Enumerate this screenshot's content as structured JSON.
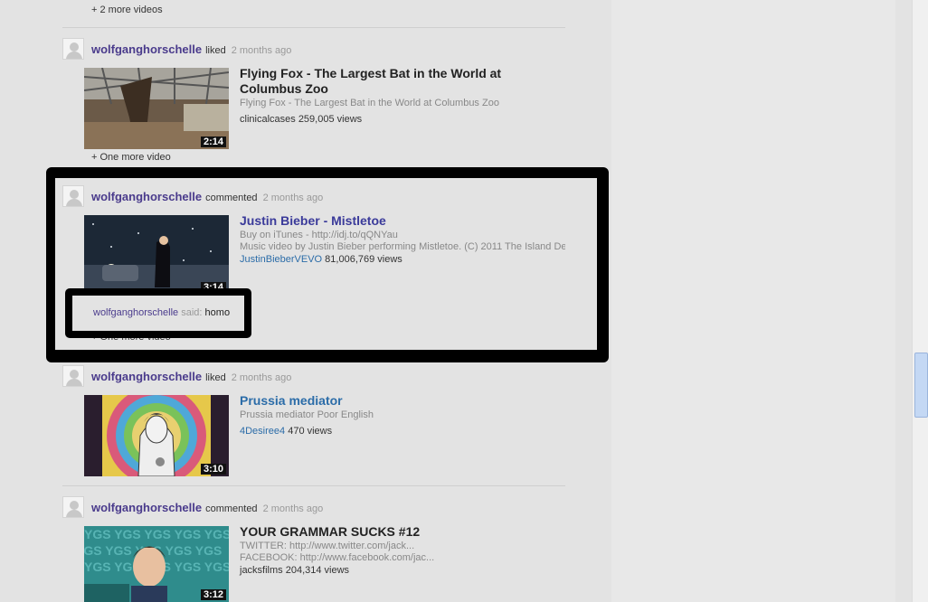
{
  "feed": {
    "top_more_link": "+ 2 more videos",
    "items": [
      {
        "user": "wolfganghorschelle",
        "action": "liked",
        "time": "2 months ago",
        "title": "Flying Fox - The Largest Bat in the World at Columbus Zoo",
        "description": [
          "Flying Fox - The Largest Bat in the World at Columbus Zoo"
        ],
        "channel": "clinicalcases",
        "views": "259,005 views",
        "duration": "2:14",
        "more_link": "+ One more video"
      },
      {
        "user": "wolfganghorschelle",
        "action": "commented",
        "time": "2 months ago",
        "title": "Justin Bieber - Mistletoe",
        "description": [
          "Buy on iTunes - http://idj.to/qQNYau",
          "Music video by Justin Bieber performing Mistletoe. (C) 2011 The Island Def"
        ],
        "channel": "JustinBieberVEVO",
        "views": "81,006,769 views",
        "duration": "3:14",
        "more_link": "+ One more video",
        "comment": {
          "user": "wolfganghorschelle",
          "said": "said:",
          "text": "homo"
        }
      },
      {
        "user": "wolfganghorschelle",
        "action": "liked",
        "time": "2 months ago",
        "title": "Prussia mediator",
        "description": [
          "Prussia mediator Poor English"
        ],
        "channel": "4Desiree4",
        "views": "470 views",
        "duration": "3:10"
      },
      {
        "user": "wolfganghorschelle",
        "action": "commented",
        "time": "2 months ago",
        "title": "YOUR GRAMMAR SUCKS #12",
        "description": [
          "TWITTER: http://www.twitter.com/jack...",
          "FACEBOOK: http://www.facebook.com/jac..."
        ],
        "channel": "jacksfilms",
        "views": "204,314 views",
        "duration": "3:12"
      }
    ]
  },
  "colors": {
    "background": "#e3e3e3",
    "username": "#4a3b8c",
    "link_blue": "#2b6ca8",
    "annotation_box": "#000000"
  }
}
